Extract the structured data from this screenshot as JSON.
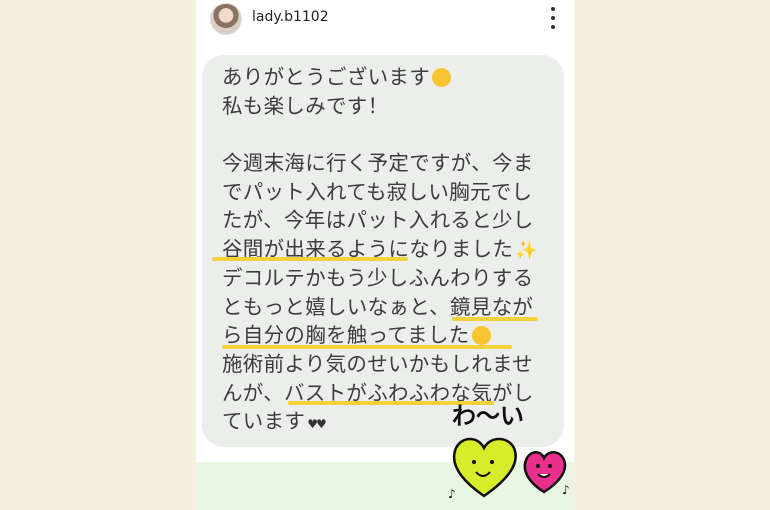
{
  "header": {
    "username": "lady.b1102"
  },
  "message": {
    "lines": [
      "ありがとうございます",
      "私も楽しみです！",
      "",
      "今週末海に行く予定ですが、今ま",
      "でパット入れても寂しい胸元でし",
      "たが、今年はパット入れると少し",
      "谷間が出来るようになりました",
      "デコルテかもう少しふんわりする",
      "ともっと嬉しいなぁと、鏡見なが",
      "ら自分の胸を触ってました",
      "施術前より気のせいかもしれませ",
      "んが、バストがふわふわな気がし",
      "ています"
    ]
  },
  "sticker": {
    "text": "わ〜い"
  },
  "colors": {
    "highlight": "#f2d23a",
    "bubble": "#ebeeeb",
    "background": "#f6efdc"
  }
}
